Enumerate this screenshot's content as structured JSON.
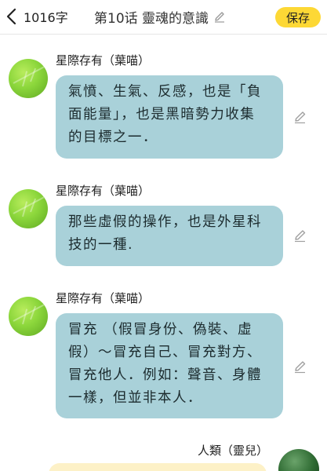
{
  "header": {
    "word_count": "1016字",
    "title": "第10话 靈魂的意識",
    "save_label": "保存"
  },
  "messages": [
    {
      "sender": "星際存有（葉喵）",
      "lines": [
        "氣憤、生氣、反感，也是「負",
        "面能量」，也是黑暗勢力收集",
        "的目標之一．"
      ]
    },
    {
      "sender": "星際存有（葉喵）",
      "lines": [
        "那些虛假的操作，也是外星科",
        "技的一種."
      ]
    },
    {
      "sender": "星際存有（葉喵）",
      "lines": [
        "冒充 （假冒身份、偽裝、虛",
        "假）～冒充自己、冒充對方、",
        "冒充他人．例如：聲音、身體",
        "一樣，但並非本人．"
      ]
    }
  ],
  "reply": {
    "sender": "人類（靈兒）"
  },
  "icons": {
    "back": "chevron-left-icon",
    "title_edit": "pencil-icon",
    "message_edit": "pencil-icon"
  },
  "colors": {
    "save_button": "#fdd835",
    "bubble": "#a9d1d9",
    "reply_bubble": "#fdf1c7"
  }
}
